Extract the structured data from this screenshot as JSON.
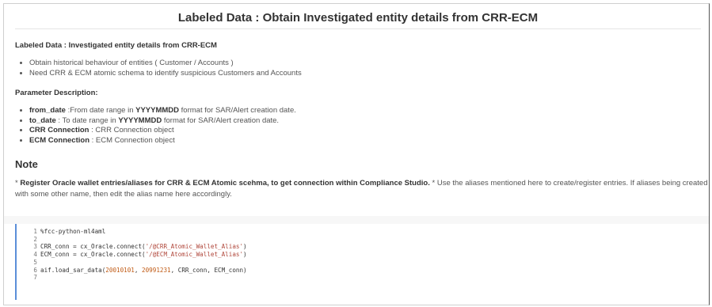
{
  "title": "Labeled Data : Obtain Investigated entity details from CRR-ECM",
  "section_heading": "Labeled Data : Investigated entity details from CRR-ECM",
  "bullets": [
    "Obtain historical behaviour of entities ( Customer / Accounts )",
    "Need CRR & ECM atomic schema to identify suspicious Customers and Accounts"
  ],
  "param_heading": "Parameter Description:",
  "params": [
    {
      "name": "from_date",
      "pre": " :From date range in ",
      "fmt": "YYYYMMDD",
      "post": " format for SAR/Alert creation date."
    },
    {
      "name": "to_date",
      "pre": " : To date range in ",
      "fmt": "YYYYMMDD",
      "post": " format for SAR/Alert creation date."
    },
    {
      "name": "CRR Connection",
      "pre": " : CRR Connection object",
      "fmt": "",
      "post": ""
    },
    {
      "name": "ECM Connection",
      "pre": " : ECM Connection object",
      "fmt": "",
      "post": ""
    }
  ],
  "note_heading": "Note",
  "note": {
    "star1": "* ",
    "bold": "Register Oracle wallet entries/aliases for CRR & ECM Atomic scehma, to get connection within Compliance Studio.",
    "rest": " * Use the aliases mentioned here to create/register entries. If aliases being created with some other name, then edit the alias name here accordingly."
  },
  "code": {
    "line_numbers": [
      "1",
      "2",
      "3",
      "4",
      "5",
      "6",
      "7"
    ],
    "line1": "%fcc-python-ml4aml",
    "line3_a": "CRR_conn = cx_Oracle.connect(",
    "line3_s": "'/@CRR_Atomic_Wallet_Alias'",
    "line3_b": ")",
    "line4_a": "ECM_conn = cx_Oracle.connect(",
    "line4_s": "'/@ECM_Atomic_Wallet_Alias'",
    "line4_b": ")",
    "line6_a": "aif.load_sar_data(",
    "line6_n1": "20010101",
    "line6_sep": ", ",
    "line6_n2": "20991231",
    "line6_b": ", CRR_conn, ECM_conn)"
  }
}
